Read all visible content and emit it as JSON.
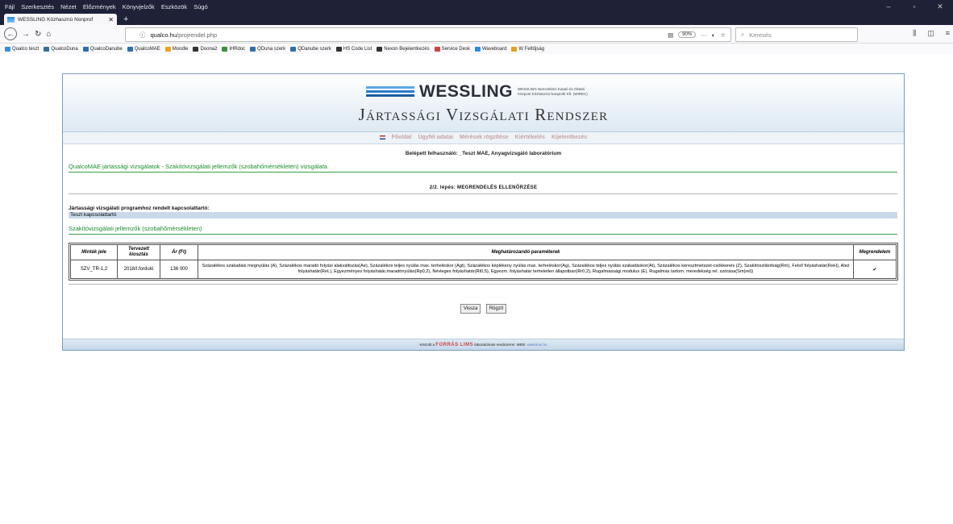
{
  "browser": {
    "menu": [
      "Fájl",
      "Szerkesztés",
      "Nézet",
      "Előzmények",
      "Könyvjelzők",
      "Eszközök",
      "Súgó"
    ],
    "tab_title": "WESSLING Közhasznú Nonprof",
    "url_host": "qualco.hu",
    "url_path": "/projrendel.php",
    "zoom": "90%",
    "search_placeholder": "Keresés",
    "bookmarks": [
      {
        "label": "Qualco teszt",
        "color": "#3a8fd6"
      },
      {
        "label": "QualcoDuna",
        "color": "#2e6fa8"
      },
      {
        "label": "QualcoDanube",
        "color": "#2e6fa8"
      },
      {
        "label": "QualcoMAE",
        "color": "#2e6fa8"
      },
      {
        "label": "Moodle",
        "color": "#f0a020"
      },
      {
        "label": "Doona2",
        "color": "#333333"
      },
      {
        "label": "iHRdoc",
        "color": "#3c8f3c"
      },
      {
        "label": "QDuna szerk",
        "color": "#2e6fa8"
      },
      {
        "label": "QDanube szerk",
        "color": "#2e6fa8"
      },
      {
        "label": "HS Code List",
        "color": "#333333"
      },
      {
        "label": "Nexon Bejelentkezés",
        "color": "#333333"
      },
      {
        "label": "Service Desk",
        "color": "#d04040"
      },
      {
        "label": "Waveboard",
        "color": "#2b8de0"
      },
      {
        "label": "W Feltűjság",
        "color": "#e0a020"
      }
    ]
  },
  "header": {
    "brand": "WESSLING",
    "brand_sub1": "WESSLING Nemzetközi Kutató és Oktató",
    "brand_sub2": "Központ Közhasznú Nonprofit Kft. (WIREC)",
    "system_name": "Jártassági Vizsgálati Rendszer"
  },
  "nav": [
    "Főoldal",
    "Ügyfél adatai",
    "Mérések rögzítése",
    "Kiértékelés",
    "Kijelentkezés"
  ],
  "user_line": "Belépett felhasználó: _Teszt MAE, Anyagvizsgáló laboratórium",
  "section_title": "QualcoMAE jártassági vizsgálatok - Szakítóvizsgálati jellemzők (szobahőmérsékleten) vizsgálata",
  "step": "2/2. lépés: MEGRENDELÉS ELLENŐRZÉSE",
  "contact_label": "Jártassági vizsgálati programhoz rendelt kapcsolattartó:",
  "contact_value": "Teszt kapcsolattartó",
  "subsection_title": "Szakítóvizsgálati jellemzők (szobahőmérsékleten)",
  "table": {
    "headers": [
      "Minták jele",
      "Tervezett kiosztás",
      "Ár (Ft)",
      "Meghatározandó paraméterek",
      "Megrendelem"
    ],
    "rows": [
      {
        "jel": "SZV_TR-1,2",
        "kiosztas": "2018/I.forduló",
        "ar": "136 000",
        "parameterek": "Százalékos szakadási megnyúlás (A), Százalékos maradó folyási alakváltozás(Ae), Százalékos teljes nyúlás max. terheléskor (Agt), Százalékos képlékeny nyúlás max. terheléskor(Ag), Százalékos teljes nyúlás szakadáskor(At), Százalékos keresztmetszet-csökkenés (Z), Szakítószilárdság(Rm), Felső folyáshatár(ReH), Alsó folyáshatár(ReL), Egyezményes folyáshatár,maradónyúlás(Rp0,2), Névleges folyáshatár(Rt0,5), Egyezm. folyáshatár terheletlen állapotban(Rr0,2), Rugalmassági modulus (E), Rugalmas tartom. meredekség rel. szórása(Sm(rel))",
        "megrendelem": "✔"
      }
    ]
  },
  "buttons": {
    "back": "Vissza",
    "save": "Rögzít"
  },
  "footer": {
    "prefix": "Készült a",
    "brand": "FORRÁS LIMS",
    "suffix": "laboratóriumi rendszerrel. WEB:",
    "url": "www.lims.hu"
  }
}
